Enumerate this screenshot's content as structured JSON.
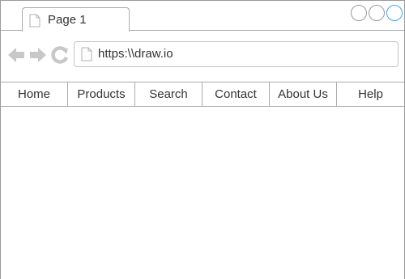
{
  "tab": {
    "title": "Page 1",
    "icon": "page-icon"
  },
  "window_controls": [
    {
      "name": "window-button-1",
      "accent": false
    },
    {
      "name": "window-button-2",
      "accent": false
    },
    {
      "name": "window-button-3",
      "accent": true
    }
  ],
  "toolbar": {
    "back_icon": "back-arrow-icon",
    "forward_icon": "forward-arrow-icon",
    "reload_icon": "reload-icon",
    "url": "https:\\\\draw.io"
  },
  "menu": {
    "items": [
      {
        "label": "Home"
      },
      {
        "label": "Products"
      },
      {
        "label": "Search"
      },
      {
        "label": "Contact"
      },
      {
        "label": "About Us"
      },
      {
        "label": "Help"
      }
    ]
  },
  "colors": {
    "accent": "#3fa9f5",
    "icon_gray": "#c8c8c8",
    "border": "#aaaaaa"
  }
}
